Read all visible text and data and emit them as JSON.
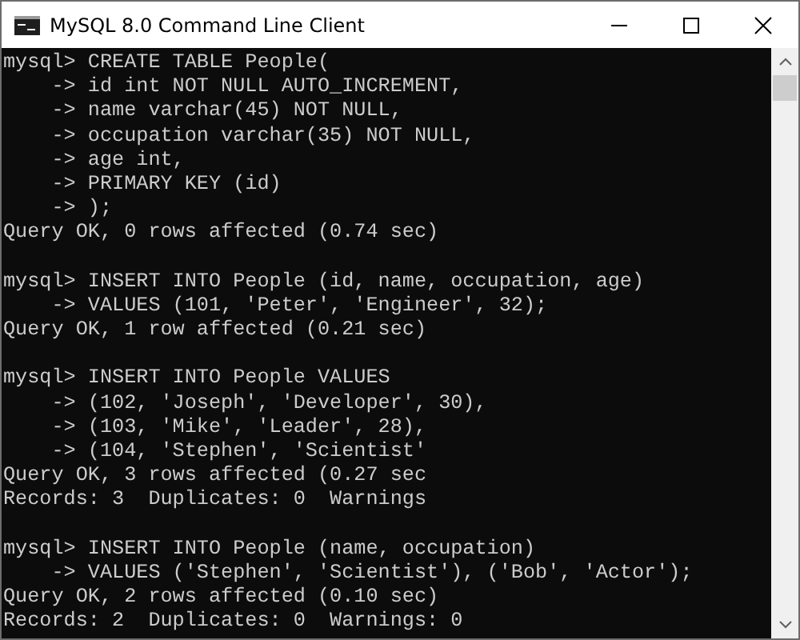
{
  "window": {
    "title": "MySQL 8.0 Command Line Client"
  },
  "console": {
    "lines": [
      {
        "kind": "text",
        "text": "mysql> CREATE TABLE People("
      },
      {
        "kind": "text",
        "text": "    -> id int NOT NULL AUTO_INCREMENT,"
      },
      {
        "kind": "text",
        "text": "    -> name varchar(45) NOT NULL,"
      },
      {
        "kind": "text",
        "text": "    -> occupation varchar(35) NOT NULL,"
      },
      {
        "kind": "text",
        "text": "    -> age int,"
      },
      {
        "kind": "text",
        "text": "    -> PRIMARY KEY (id)"
      },
      {
        "kind": "text",
        "text": "    -> );"
      },
      {
        "kind": "text",
        "text": "Query OK, 0 rows affected (0.74 sec)"
      },
      {
        "kind": "blank"
      },
      {
        "kind": "text",
        "text": "mysql> INSERT INTO People (id, name, occupation, age)"
      },
      {
        "kind": "text",
        "text": "    -> VALUES (101, 'Peter', 'Engineer', 32);"
      },
      {
        "kind": "text",
        "text": "Query OK, 1 row affected (0.21 sec)"
      },
      {
        "kind": "blank"
      },
      {
        "kind": "text",
        "text": "mysql> INSERT INTO People VALUES"
      },
      {
        "kind": "text",
        "text": "    -> (102, 'Joseph', 'Developer', 30),"
      },
      {
        "kind": "text",
        "text": "    -> (103, 'Mike', 'Leader', 28),"
      },
      {
        "kind": "text",
        "text": "    -> (104, 'Stephen', 'Scientist'"
      },
      {
        "kind": "text",
        "text": "Query OK, 3 rows affected (0.27 sec"
      },
      {
        "kind": "text",
        "text": "Records: 3  Duplicates: 0  Warnings"
      },
      {
        "kind": "blank"
      },
      {
        "kind": "text",
        "text": "mysql> INSERT INTO People (name, occupation)"
      },
      {
        "kind": "text",
        "text": "    -> VALUES ('Stephen', 'Scientist'), ('Bob', 'Actor');"
      },
      {
        "kind": "text",
        "text": "Query OK, 2 rows affected (0.10 sec)"
      },
      {
        "kind": "text",
        "text": "Records: 2  Duplicates: 0  Warnings: 0"
      }
    ]
  }
}
